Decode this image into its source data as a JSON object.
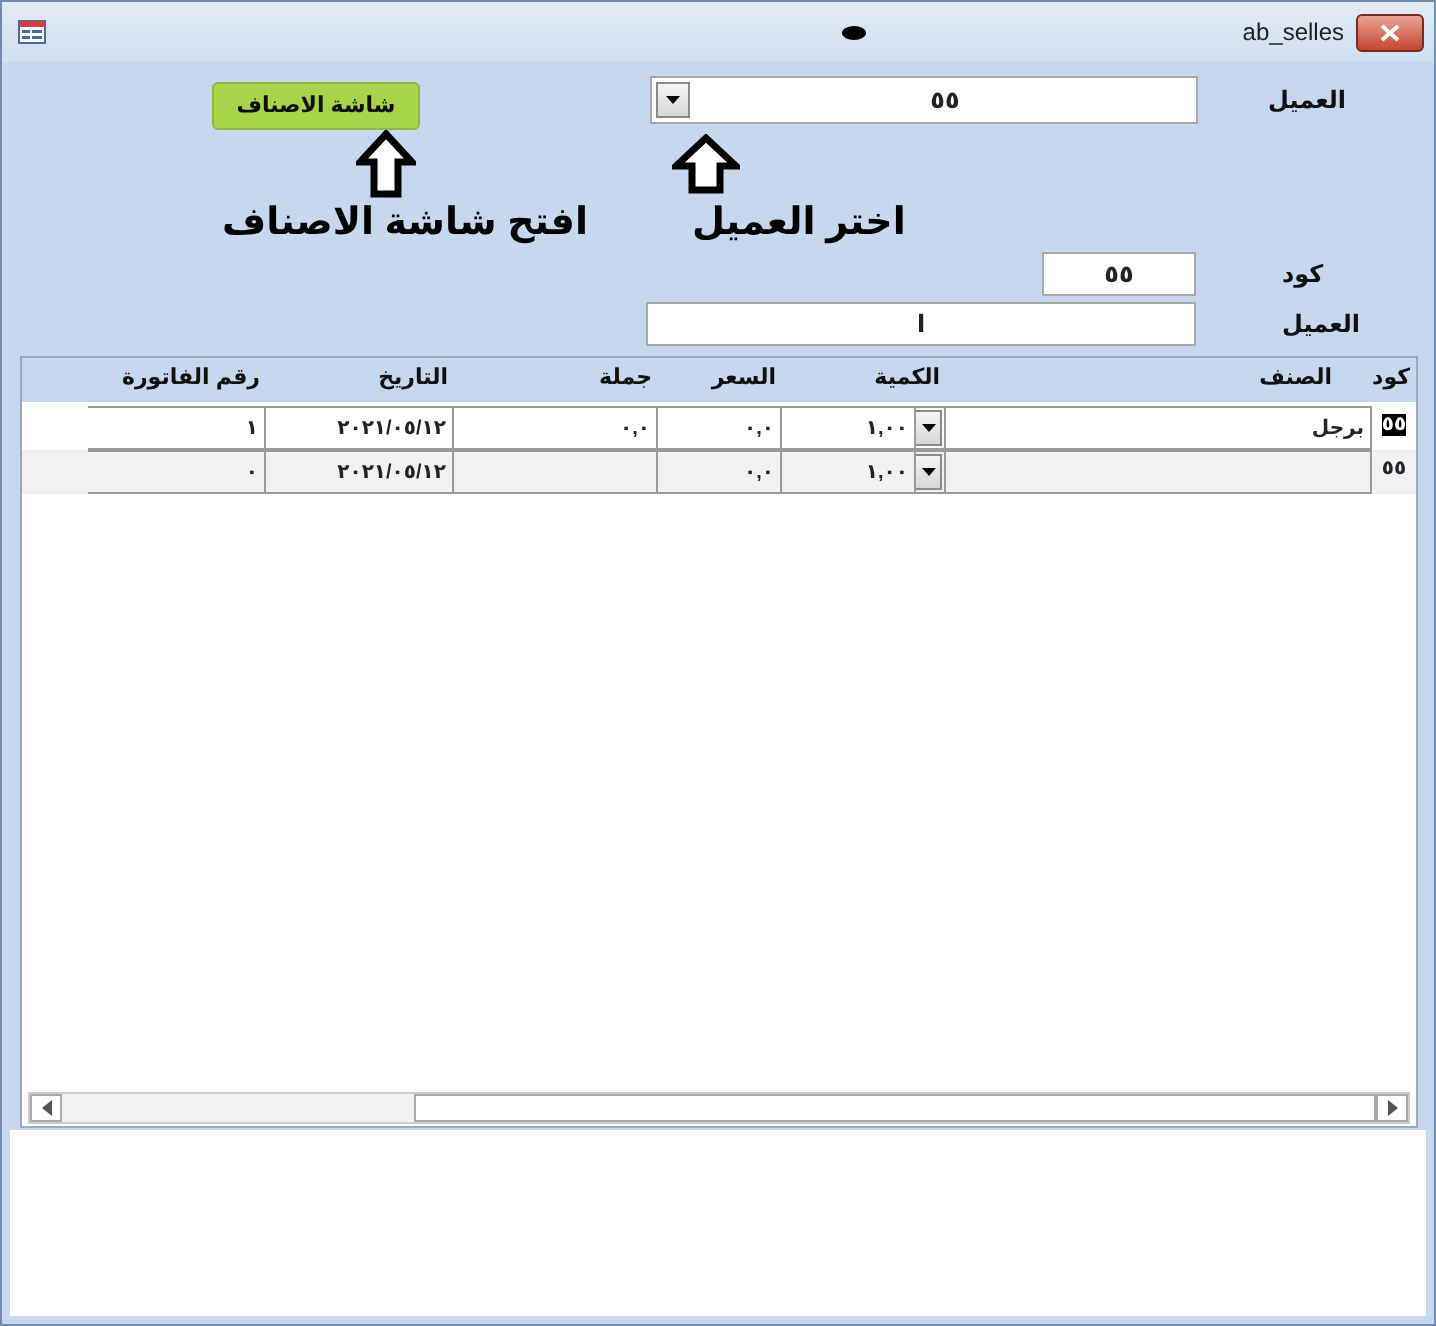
{
  "window": {
    "title": "ab_selles"
  },
  "header": {
    "customer_label": "العميل",
    "customer_value": "٥٥",
    "items_button": "شاشة الاصناف",
    "hint_open": "افتح شاشة الاصناف",
    "hint_choose": "اختر العميل",
    "code_label": "كود",
    "code_value": "٥٥",
    "name_label": "العميل",
    "name_value": "ا"
  },
  "table": {
    "columns": [
      "كود",
      "الصنف",
      "الكمية",
      "السعر",
      "جملة",
      "التاريخ",
      "رقم الفاتورة"
    ],
    "rows": [
      {
        "selected": true,
        "cells": [
          "٥٥",
          "برجل",
          "١,٠٠",
          "٠,٠",
          "٠,٠",
          "٢٠٢١/٠٥/١٢",
          "١"
        ]
      },
      {
        "selected": false,
        "cells": [
          "٥٥",
          null,
          "١,٠٠",
          "٠,٠",
          null,
          "٢٠٢١/٠٥/١٢",
          "٠"
        ]
      }
    ]
  }
}
